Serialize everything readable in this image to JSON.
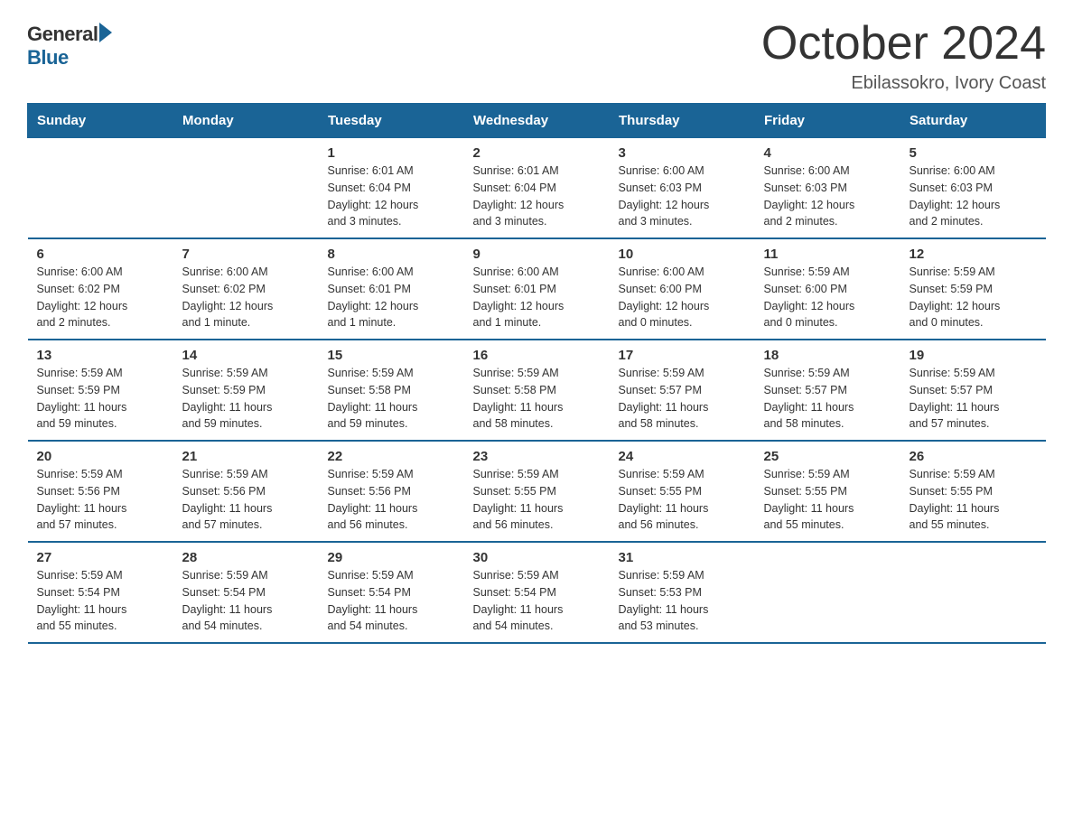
{
  "logo": {
    "general": "General",
    "blue": "Blue"
  },
  "title": "October 2024",
  "subtitle": "Ebilassokro, Ivory Coast",
  "headers": [
    "Sunday",
    "Monday",
    "Tuesday",
    "Wednesday",
    "Thursday",
    "Friday",
    "Saturday"
  ],
  "weeks": [
    [
      {
        "day": "",
        "info": ""
      },
      {
        "day": "",
        "info": ""
      },
      {
        "day": "1",
        "info": "Sunrise: 6:01 AM\nSunset: 6:04 PM\nDaylight: 12 hours\nand 3 minutes."
      },
      {
        "day": "2",
        "info": "Sunrise: 6:01 AM\nSunset: 6:04 PM\nDaylight: 12 hours\nand 3 minutes."
      },
      {
        "day": "3",
        "info": "Sunrise: 6:00 AM\nSunset: 6:03 PM\nDaylight: 12 hours\nand 3 minutes."
      },
      {
        "day": "4",
        "info": "Sunrise: 6:00 AM\nSunset: 6:03 PM\nDaylight: 12 hours\nand 2 minutes."
      },
      {
        "day": "5",
        "info": "Sunrise: 6:00 AM\nSunset: 6:03 PM\nDaylight: 12 hours\nand 2 minutes."
      }
    ],
    [
      {
        "day": "6",
        "info": "Sunrise: 6:00 AM\nSunset: 6:02 PM\nDaylight: 12 hours\nand 2 minutes."
      },
      {
        "day": "7",
        "info": "Sunrise: 6:00 AM\nSunset: 6:02 PM\nDaylight: 12 hours\nand 1 minute."
      },
      {
        "day": "8",
        "info": "Sunrise: 6:00 AM\nSunset: 6:01 PM\nDaylight: 12 hours\nand 1 minute."
      },
      {
        "day": "9",
        "info": "Sunrise: 6:00 AM\nSunset: 6:01 PM\nDaylight: 12 hours\nand 1 minute."
      },
      {
        "day": "10",
        "info": "Sunrise: 6:00 AM\nSunset: 6:00 PM\nDaylight: 12 hours\nand 0 minutes."
      },
      {
        "day": "11",
        "info": "Sunrise: 5:59 AM\nSunset: 6:00 PM\nDaylight: 12 hours\nand 0 minutes."
      },
      {
        "day": "12",
        "info": "Sunrise: 5:59 AM\nSunset: 5:59 PM\nDaylight: 12 hours\nand 0 minutes."
      }
    ],
    [
      {
        "day": "13",
        "info": "Sunrise: 5:59 AM\nSunset: 5:59 PM\nDaylight: 11 hours\nand 59 minutes."
      },
      {
        "day": "14",
        "info": "Sunrise: 5:59 AM\nSunset: 5:59 PM\nDaylight: 11 hours\nand 59 minutes."
      },
      {
        "day": "15",
        "info": "Sunrise: 5:59 AM\nSunset: 5:58 PM\nDaylight: 11 hours\nand 59 minutes."
      },
      {
        "day": "16",
        "info": "Sunrise: 5:59 AM\nSunset: 5:58 PM\nDaylight: 11 hours\nand 58 minutes."
      },
      {
        "day": "17",
        "info": "Sunrise: 5:59 AM\nSunset: 5:57 PM\nDaylight: 11 hours\nand 58 minutes."
      },
      {
        "day": "18",
        "info": "Sunrise: 5:59 AM\nSunset: 5:57 PM\nDaylight: 11 hours\nand 58 minutes."
      },
      {
        "day": "19",
        "info": "Sunrise: 5:59 AM\nSunset: 5:57 PM\nDaylight: 11 hours\nand 57 minutes."
      }
    ],
    [
      {
        "day": "20",
        "info": "Sunrise: 5:59 AM\nSunset: 5:56 PM\nDaylight: 11 hours\nand 57 minutes."
      },
      {
        "day": "21",
        "info": "Sunrise: 5:59 AM\nSunset: 5:56 PM\nDaylight: 11 hours\nand 57 minutes."
      },
      {
        "day": "22",
        "info": "Sunrise: 5:59 AM\nSunset: 5:56 PM\nDaylight: 11 hours\nand 56 minutes."
      },
      {
        "day": "23",
        "info": "Sunrise: 5:59 AM\nSunset: 5:55 PM\nDaylight: 11 hours\nand 56 minutes."
      },
      {
        "day": "24",
        "info": "Sunrise: 5:59 AM\nSunset: 5:55 PM\nDaylight: 11 hours\nand 56 minutes."
      },
      {
        "day": "25",
        "info": "Sunrise: 5:59 AM\nSunset: 5:55 PM\nDaylight: 11 hours\nand 55 minutes."
      },
      {
        "day": "26",
        "info": "Sunrise: 5:59 AM\nSunset: 5:55 PM\nDaylight: 11 hours\nand 55 minutes."
      }
    ],
    [
      {
        "day": "27",
        "info": "Sunrise: 5:59 AM\nSunset: 5:54 PM\nDaylight: 11 hours\nand 55 minutes."
      },
      {
        "day": "28",
        "info": "Sunrise: 5:59 AM\nSunset: 5:54 PM\nDaylight: 11 hours\nand 54 minutes."
      },
      {
        "day": "29",
        "info": "Sunrise: 5:59 AM\nSunset: 5:54 PM\nDaylight: 11 hours\nand 54 minutes."
      },
      {
        "day": "30",
        "info": "Sunrise: 5:59 AM\nSunset: 5:54 PM\nDaylight: 11 hours\nand 54 minutes."
      },
      {
        "day": "31",
        "info": "Sunrise: 5:59 AM\nSunset: 5:53 PM\nDaylight: 11 hours\nand 53 minutes."
      },
      {
        "day": "",
        "info": ""
      },
      {
        "day": "",
        "info": ""
      }
    ]
  ]
}
